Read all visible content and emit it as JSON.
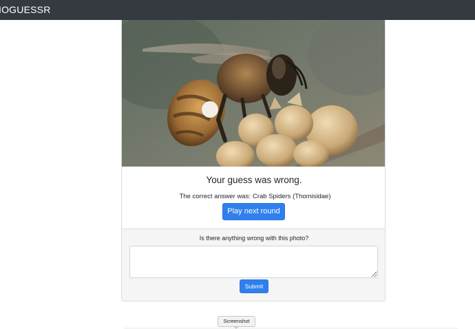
{
  "navbar": {
    "brand": "IOGUESSR"
  },
  "photo": {
    "subject": "honeybee-on-flower-buds"
  },
  "result": {
    "title": "Your guess was wrong.",
    "answer_prefix": "The correct answer was:",
    "answer_value": "Crab Spiders (Thomisidae)",
    "play_next_label": "Play next round"
  },
  "report": {
    "question": "Is there anything wrong with this photo?",
    "textarea_value": "",
    "submit_label": "Submit"
  },
  "tooltip": {
    "label": "Screenshot"
  },
  "colors": {
    "navbar_bg": "#343a40",
    "primary_button": "#2f80ed",
    "report_bg": "#f5f5f5"
  }
}
